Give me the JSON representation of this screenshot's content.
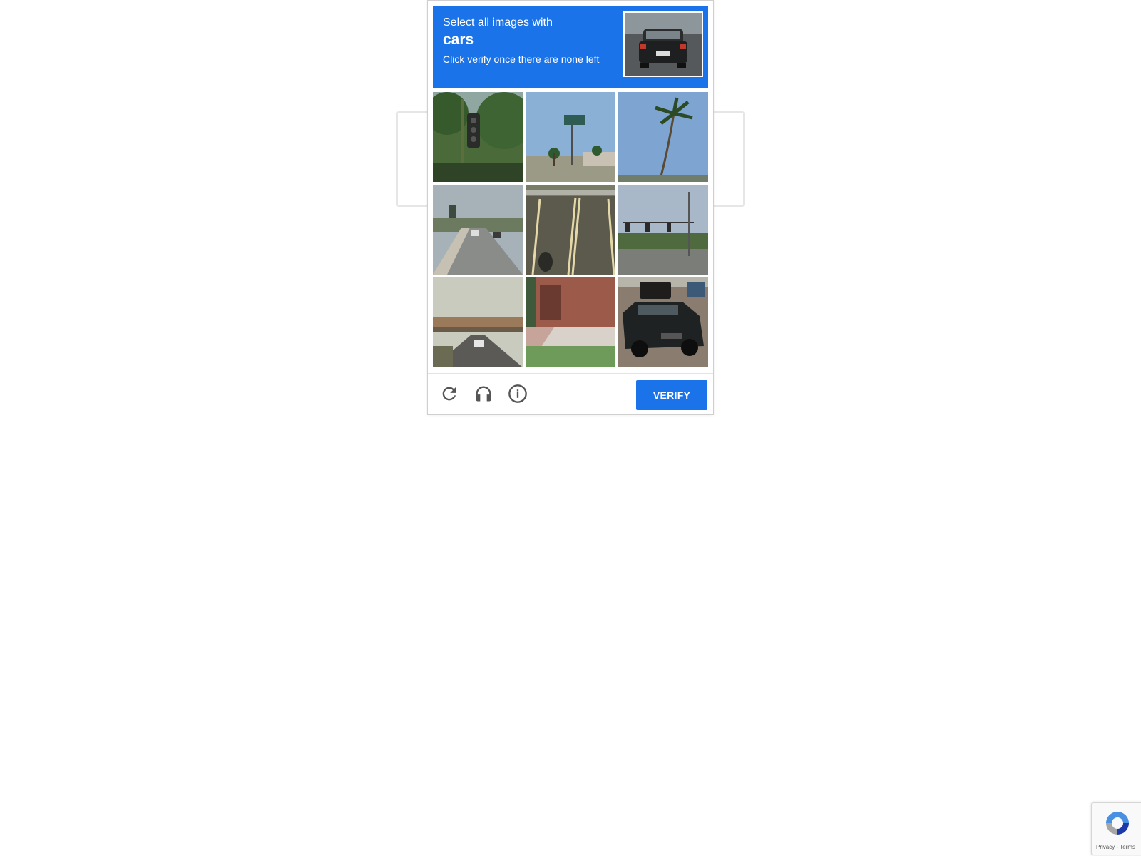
{
  "challenge": {
    "instruction_line1": "Select all images with",
    "keyword": "cars",
    "instruction_line3": "Click verify once there are none left",
    "sample_image": "car-rear-sample",
    "tiles": [
      {
        "index": 1,
        "scene": "traffic-light-trees"
      },
      {
        "index": 2,
        "scene": "sign-pole-palms"
      },
      {
        "index": 3,
        "scene": "palm-tree-sky"
      },
      {
        "index": 4,
        "scene": "road-with-cars"
      },
      {
        "index": 5,
        "scene": "road-lane-lines"
      },
      {
        "index": 6,
        "scene": "intersection-traffic-lights"
      },
      {
        "index": 7,
        "scene": "highway-overpass-car"
      },
      {
        "index": 8,
        "scene": "brick-building-steps"
      },
      {
        "index": 9,
        "scene": "parked-suv"
      }
    ]
  },
  "footer": {
    "reload_icon": "reload-icon",
    "audio_icon": "headphones-icon",
    "info_icon": "info-icon",
    "verify_label": "VERIFY"
  },
  "badge": {
    "links": "Privacy - Terms"
  },
  "colors": {
    "accent": "#1a73e8",
    "icon_gray": "#555555"
  }
}
